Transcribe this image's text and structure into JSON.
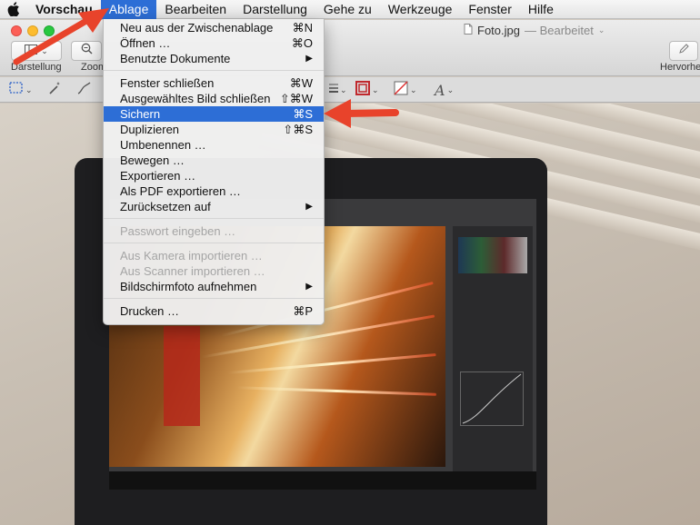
{
  "menubar": {
    "app_name": "Vorschau",
    "items": [
      "Ablage",
      "Bearbeiten",
      "Darstellung",
      "Gehe zu",
      "Werkzeuge",
      "Fenster",
      "Hilfe"
    ],
    "active_item": "Ablage"
  },
  "window": {
    "document_title": "Foto.jpg",
    "document_status": "— Bearbeitet",
    "toolbar": {
      "view_label": "Darstellung",
      "zoom_label": "Zoom",
      "highlight_label": "Hervorhe"
    }
  },
  "ablage_menu": {
    "items": [
      {
        "label": "Neu aus der Zwischenablage",
        "shortcut": "⌘N"
      },
      {
        "label": "Öffnen …",
        "shortcut": "⌘O"
      },
      {
        "label": "Benutzte Dokumente",
        "submenu": "▶"
      },
      {
        "label": "Fenster schließen",
        "shortcut": "⌘W"
      },
      {
        "label": "Ausgewähltes Bild schließen",
        "shortcut": "⇧⌘W"
      },
      {
        "label": "Sichern",
        "shortcut": "⌘S",
        "highlighted": true
      },
      {
        "label": "Duplizieren",
        "shortcut": "⇧⌘S"
      },
      {
        "label": "Umbenennen …"
      },
      {
        "label": "Bewegen …"
      },
      {
        "label": "Exportieren …"
      },
      {
        "label": "Als PDF exportieren …"
      },
      {
        "label": "Zurücksetzen auf",
        "submenu": "▶"
      },
      {
        "label": "Passwort eingeben …",
        "disabled": true
      },
      {
        "label": "Aus Kamera importieren …",
        "disabled": true
      },
      {
        "label": "Aus Scanner importieren …",
        "disabled": true
      },
      {
        "label": "Bildschirmfoto aufnehmen",
        "submenu": "▶"
      },
      {
        "label": "Drucken …",
        "shortcut": "⌘P"
      }
    ]
  },
  "icons": {
    "apple": "apple-logo-icon",
    "sidebar": "sidebar-view-icon",
    "zoom": "magnifier-icon",
    "markup": "pen-icon",
    "select": "rect-select-icon",
    "wand": "magic-wand-icon",
    "sketch": "sketch-icon",
    "border": "border-color-icon",
    "fill": "fill-color-icon",
    "text_style": "text-style-icon",
    "document": "document-icon"
  },
  "colors": {
    "menu_highlight": "#2d6ed6",
    "annotation_arrow": "#e8432b"
  }
}
